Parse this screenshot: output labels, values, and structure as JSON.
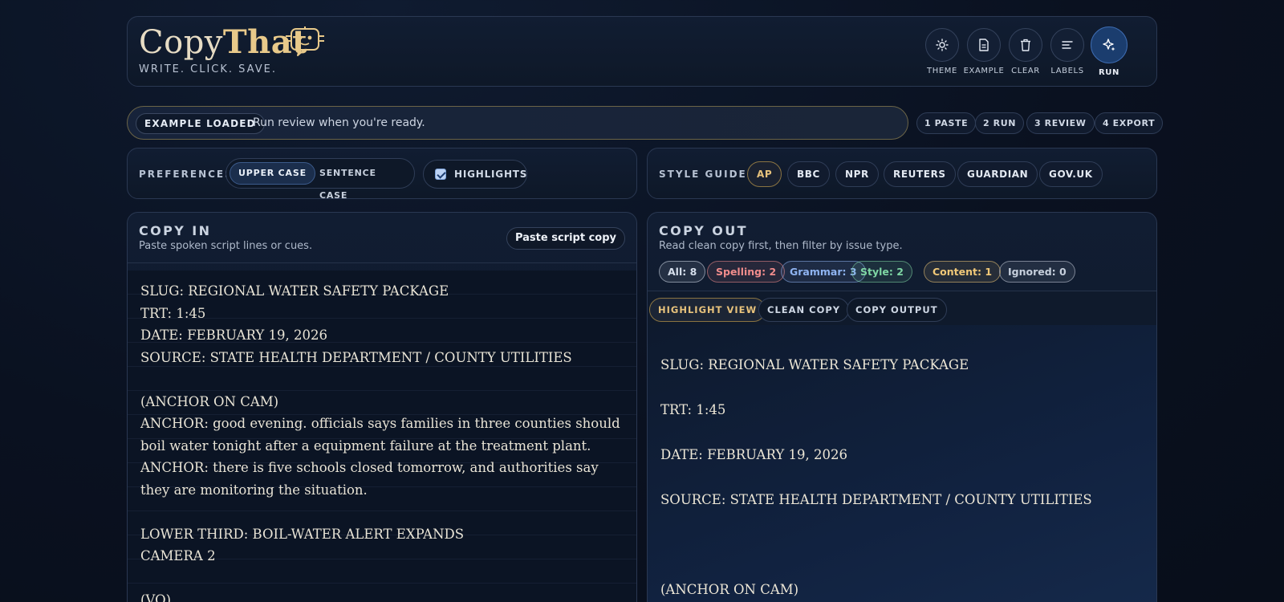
{
  "brand": {
    "name_light": "Copy",
    "name_bold": "That",
    "tagline": "WRITE. CLICK. SAVE."
  },
  "toolbar": [
    {
      "label": "THEME",
      "icon": "sun-icon"
    },
    {
      "label": "EXAMPLE",
      "icon": "document-icon"
    },
    {
      "label": "CLEAR",
      "icon": "trash-icon"
    },
    {
      "label": "LABELS",
      "icon": "lines-icon"
    },
    {
      "label": "RUN",
      "icon": "sparkle-icon"
    }
  ],
  "status": {
    "badge": "EXAMPLE LOADED",
    "message": "Run review when you're ready."
  },
  "steps": [
    "1 PASTE",
    "2 RUN",
    "3 REVIEW",
    "4 EXPORT"
  ],
  "preferences": {
    "title": "PREFERENCES",
    "case_options": [
      "UPPER CASE",
      "SENTENCE CASE"
    ],
    "case_selected": "UPPER CASE",
    "highlights_label": "HIGHLIGHTS",
    "highlights_checked": true
  },
  "style_guides": {
    "title": "STYLE GUIDES",
    "options": [
      "AP",
      "BBC",
      "NPR",
      "REUTERS",
      "GUARDIAN",
      "GOV.UK"
    ],
    "selected": "AP"
  },
  "copy_in": {
    "title": "COPY IN",
    "subtitle": "Paste spoken script lines or cues.",
    "paste_button": "Paste script copy",
    "lines": [
      "SLUG: REGIONAL WATER SAFETY PACKAGE",
      "TRT: 1:45",
      "DATE: FEBRUARY 19, 2026",
      "SOURCE: STATE HEALTH DEPARTMENT / COUNTY UTILITIES",
      "",
      "(ANCHOR ON CAM)",
      "ANCHOR: good evening. officials says families in three counties should boil water tonight after a equipment failure at the treatment plant.",
      "ANCHOR: there is five schools closed tomorrow, and authorities say they are monitoring the situation.",
      "",
      "LOWER THIRD: BOIL-WATER ALERT EXPANDS",
      "CAMERA 2",
      "",
      "(VO)"
    ]
  },
  "copy_out": {
    "title": "COPY OUT",
    "subtitle": "Read clean copy first, then filter by issue type.",
    "filters": [
      {
        "label": "All: 8",
        "color": "#d6dfec"
      },
      {
        "label": "Spelling: 2",
        "color": "#f08c8c"
      },
      {
        "label": "Grammar: 3",
        "color": "#8fb4f2"
      },
      {
        "label": "Style: 2",
        "color": "#7fd6a4"
      },
      {
        "label": "Content: 1",
        "color": "#f0c878"
      },
      {
        "label": "Ignored: 0",
        "color": "#c6cfdc"
      }
    ],
    "views": [
      "HIGHLIGHT VIEW",
      "CLEAN COPY",
      "COPY OUTPUT"
    ],
    "view_selected": "HIGHLIGHT VIEW",
    "lines": [
      "SLUG: REGIONAL WATER SAFETY PACKAGE",
      "TRT: 1:45",
      "DATE: FEBRUARY 19, 2026",
      "SOURCE: STATE HEALTH DEPARTMENT / COUNTY UTILITIES",
      "",
      "(ANCHOR ON CAM)"
    ]
  },
  "colors": {
    "accent_gold": "#e8c98a",
    "run_blue": "#1b3d6e",
    "panel_border": "#2a3852"
  }
}
